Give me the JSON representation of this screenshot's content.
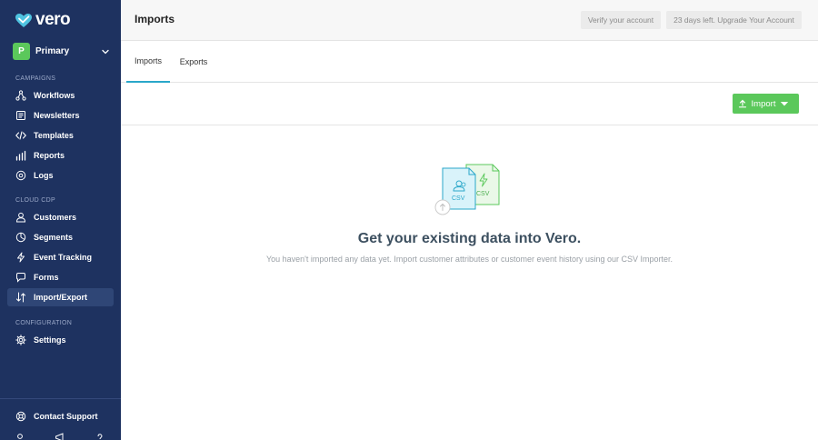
{
  "app": {
    "brand": "vero",
    "workspace_badge": "P",
    "workspace_name": "Primary"
  },
  "sidebar": {
    "sections": {
      "campaigns": "CAMPAIGNS",
      "cloud_cdp": "CLOUD CDP",
      "configuration": "CONFIGURATION"
    },
    "items": [
      {
        "label": "Workflows",
        "icon": "workflows-icon"
      },
      {
        "label": "Newsletters",
        "icon": "newsletters-icon"
      },
      {
        "label": "Templates",
        "icon": "code-icon"
      },
      {
        "label": "Reports",
        "icon": "bar-chart-icon"
      },
      {
        "label": "Logs",
        "icon": "logs-icon"
      },
      {
        "label": "Customers",
        "icon": "user-icon"
      },
      {
        "label": "Segments",
        "icon": "pie-chart-icon"
      },
      {
        "label": "Event Tracking",
        "icon": "lightning-icon"
      },
      {
        "label": "Forms",
        "icon": "forms-icon"
      },
      {
        "label": "Import/Export",
        "icon": "import-export-icon",
        "active": true
      },
      {
        "label": "Settings",
        "icon": "gear-icon"
      }
    ],
    "contact_support": "Contact Support"
  },
  "header": {
    "title": "Imports",
    "verify_label": "Verify your account",
    "trial_label": "23 days left. Upgrade Your Account"
  },
  "tabs": [
    {
      "label": "Imports",
      "active": true
    },
    {
      "label": "Exports",
      "active": false
    }
  ],
  "toolbar": {
    "import_label": "Import"
  },
  "empty_state": {
    "csv_label_front": "CSV",
    "csv_label_back": "CSV",
    "title": "Get your existing data into Vero.",
    "description": "You haven't imported any data yet. Import customer attributes or customer event history using our CSV Importer."
  },
  "colors": {
    "sidebar_bg": "#1e3260",
    "accent_green": "#5bc85b",
    "accent_teal": "#2aa7c9"
  }
}
